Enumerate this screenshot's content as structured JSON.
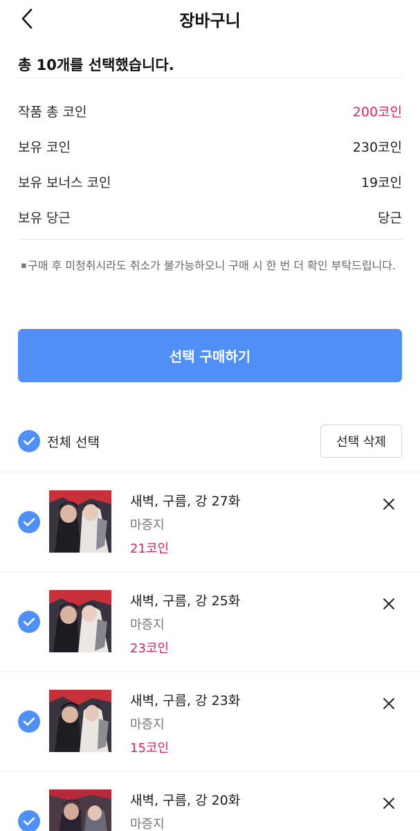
{
  "header": {
    "title": "장바구니"
  },
  "summary": {
    "title": "총 10개를 선택했습니다."
  },
  "info": [
    {
      "label": "작품 총 코인",
      "value": "200코인"
    },
    {
      "label": "보유 코인",
      "value": "230코인"
    },
    {
      "label": "보유 보너스 코인",
      "value": "19코인"
    },
    {
      "label": "보유 당근",
      "value": "당근"
    }
  ],
  "notice": {
    "bullet": "▪",
    "text": "구매 후 미청취시라도 취소가 불가능하오니 구매 시 한 번 더 확인 부탁드립니다."
  },
  "buy_button": {
    "label": "선택 구매하기"
  },
  "select_bar": {
    "select_all_label": "전체 선택",
    "delete_label": "선택 삭제"
  },
  "items": [
    {
      "title": "새벽, 구름, 강 27화",
      "author": "마증지",
      "price": "21코인"
    },
    {
      "title": "새벽, 구름, 강 25화",
      "author": "마증지",
      "price": "23코인"
    },
    {
      "title": "새벽, 구름, 강 23화",
      "author": "마증지",
      "price": "15코인"
    },
    {
      "title": "새벽, 구름, 강 20화",
      "author": "마증지",
      "price": ""
    }
  ],
  "colors": {
    "accent": "#4f8ff6",
    "price": "#d6245f"
  },
  "icons": {
    "back": "chevron-left-icon",
    "check": "check-circle-icon",
    "remove": "close-icon"
  }
}
